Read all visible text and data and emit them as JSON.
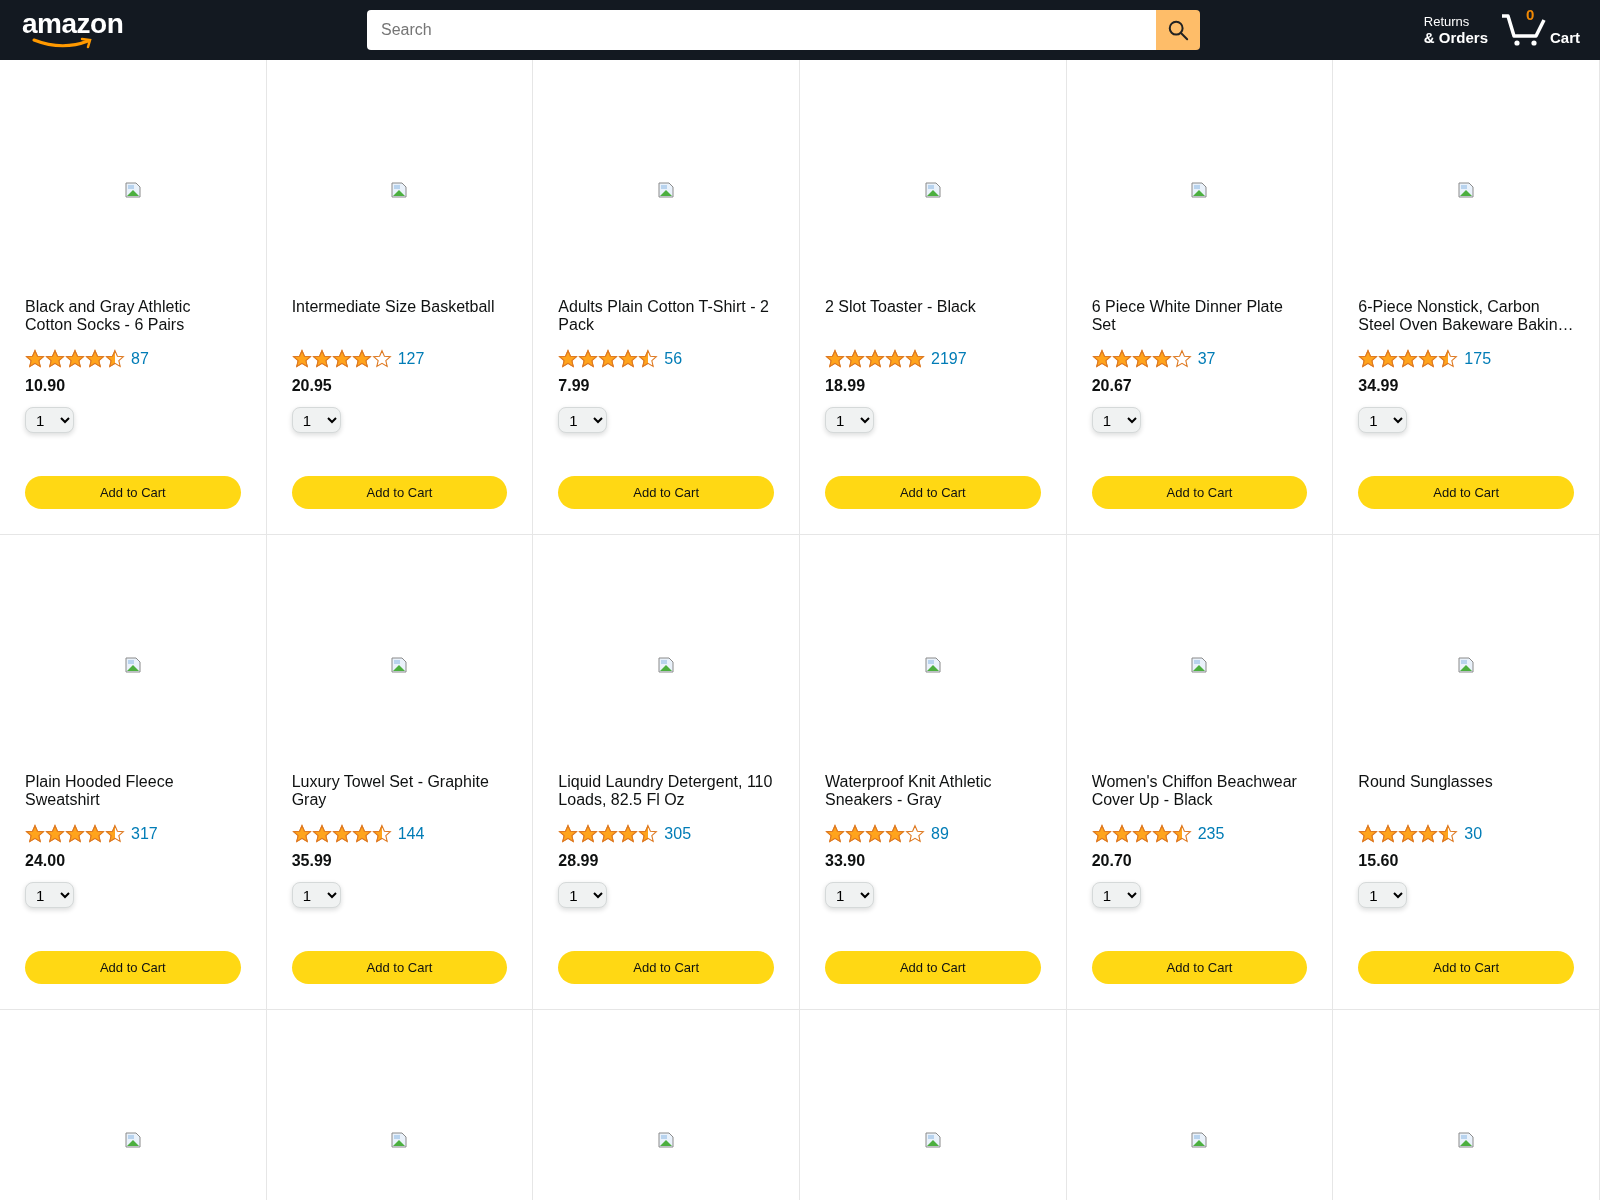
{
  "header": {
    "logo": "amazon",
    "search": {
      "placeholder": "Search"
    },
    "returns": {
      "line1": "Returns",
      "line2": "& Orders"
    },
    "cart": {
      "count": "0",
      "label": "Cart"
    }
  },
  "products": [
    {
      "kind": "full",
      "title": "Black and Gray Athletic Cotton Socks - 6 Pairs",
      "stars": 4.5,
      "reviews": "87",
      "price": "10.90",
      "quantity": "1",
      "button": "Add to Cart"
    },
    {
      "kind": "full",
      "title": "Intermediate Size Basketball",
      "stars": 4,
      "reviews": "127",
      "price": "20.95",
      "quantity": "1",
      "button": "Add to Cart"
    },
    {
      "kind": "full",
      "title": "Adults Plain Cotton T-Shirt - 2 Pack",
      "stars": 4.5,
      "reviews": "56",
      "price": "7.99",
      "quantity": "1",
      "button": "Add to Cart"
    },
    {
      "kind": "full",
      "title": "2 Slot Toaster - Black",
      "stars": 5,
      "reviews": "2197",
      "price": "18.99",
      "quantity": "1",
      "button": "Add to Cart"
    },
    {
      "kind": "full",
      "title": "6 Piece White Dinner Plate Set",
      "stars": 4,
      "reviews": "37",
      "price": "20.67",
      "quantity": "1",
      "button": "Add to Cart"
    },
    {
      "kind": "full",
      "title": "6-Piece Nonstick, Carbon Steel Oven Bakeware Bakin…",
      "stars": 4.5,
      "reviews": "175",
      "price": "34.99",
      "quantity": "1",
      "button": "Add to Cart"
    },
    {
      "kind": "full",
      "title": "Plain Hooded Fleece Sweatshirt",
      "stars": 4.5,
      "reviews": "317",
      "price": "24.00",
      "quantity": "1",
      "button": "Add to Cart"
    },
    {
      "kind": "full",
      "title": "Luxury Towel Set - Graphite Gray",
      "stars": 4.5,
      "reviews": "144",
      "price": "35.99",
      "quantity": "1",
      "button": "Add to Cart"
    },
    {
      "kind": "full",
      "title": "Liquid Laundry Detergent, 110 Loads, 82.5 Fl Oz",
      "stars": 4.5,
      "reviews": "305",
      "price": "28.99",
      "quantity": "1",
      "button": "Add to Cart"
    },
    {
      "kind": "full",
      "title": "Waterproof Knit Athletic Sneakers - Gray",
      "stars": 4,
      "reviews": "89",
      "price": "33.90",
      "quantity": "1",
      "button": "Add to Cart"
    },
    {
      "kind": "full",
      "title": "Women's Chiffon Beachwear Cover Up - Black",
      "stars": 4.5,
      "reviews": "235",
      "price": "20.70",
      "quantity": "1",
      "button": "Add to Cart"
    },
    {
      "kind": "full",
      "title": "Round Sunglasses",
      "stars": 4.5,
      "reviews": "30",
      "price": "15.60",
      "quantity": "1",
      "button": "Add to Cart"
    },
    {
      "kind": "image-only"
    },
    {
      "kind": "image-only"
    },
    {
      "kind": "image-only"
    },
    {
      "kind": "image-only"
    },
    {
      "kind": "image-only"
    },
    {
      "kind": "image-only"
    }
  ]
}
